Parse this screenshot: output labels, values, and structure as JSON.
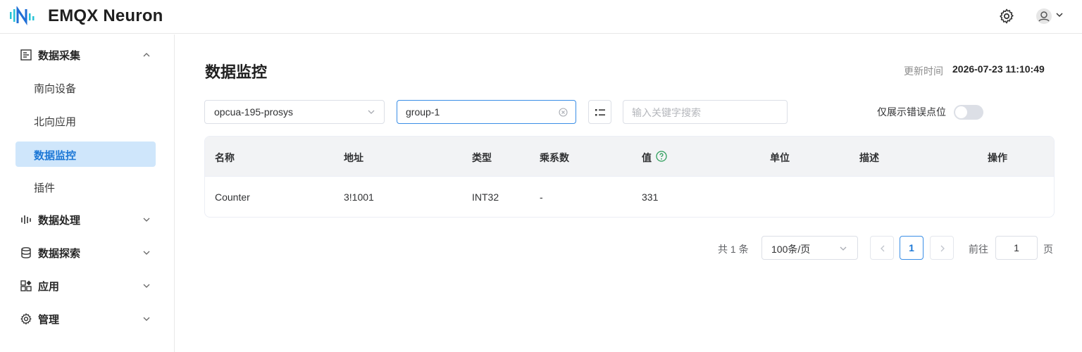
{
  "header": {
    "brand": "EMQX Neuron"
  },
  "sidebar": {
    "groups": [
      {
        "label": "数据采集",
        "icon": "data-collection-icon",
        "expanded": true,
        "items": [
          {
            "label": "南向设备"
          },
          {
            "label": "北向应用"
          },
          {
            "label": "数据监控",
            "active": true
          },
          {
            "label": "插件"
          }
        ]
      },
      {
        "label": "数据处理",
        "icon": "data-processing-icon"
      },
      {
        "label": "数据探索",
        "icon": "database-icon"
      },
      {
        "label": "应用",
        "icon": "apps-icon"
      },
      {
        "label": "管理",
        "icon": "gear-icon"
      }
    ]
  },
  "main": {
    "title": "数据监控",
    "update_label": "更新时间",
    "update_time": "2026-07-23 11:10:49",
    "filters": {
      "node_select": "opcua-195-prosys",
      "group_select": "group-1",
      "search_placeholder": "输入关键字搜索",
      "error_only_label": "仅展示错误点位",
      "error_only_on": false
    },
    "table": {
      "headers": [
        "名称",
        "地址",
        "类型",
        "乘系数",
        "值",
        "单位",
        "描述",
        "操作"
      ],
      "rows": [
        {
          "name": "Counter",
          "address": "3!1001",
          "type": "INT32",
          "multiplier": "-",
          "value": "331",
          "unit": "",
          "description": ""
        }
      ]
    },
    "pagination": {
      "total_text": "共 1 条",
      "page_size": "100条/页",
      "current_page": "1",
      "goto_label": "前往",
      "goto_value": "1",
      "page_suffix": "页"
    }
  },
  "colors": {
    "accent": "#1d78d6",
    "active_bg": "#cfe6fb",
    "help": "#2e9e5b"
  }
}
